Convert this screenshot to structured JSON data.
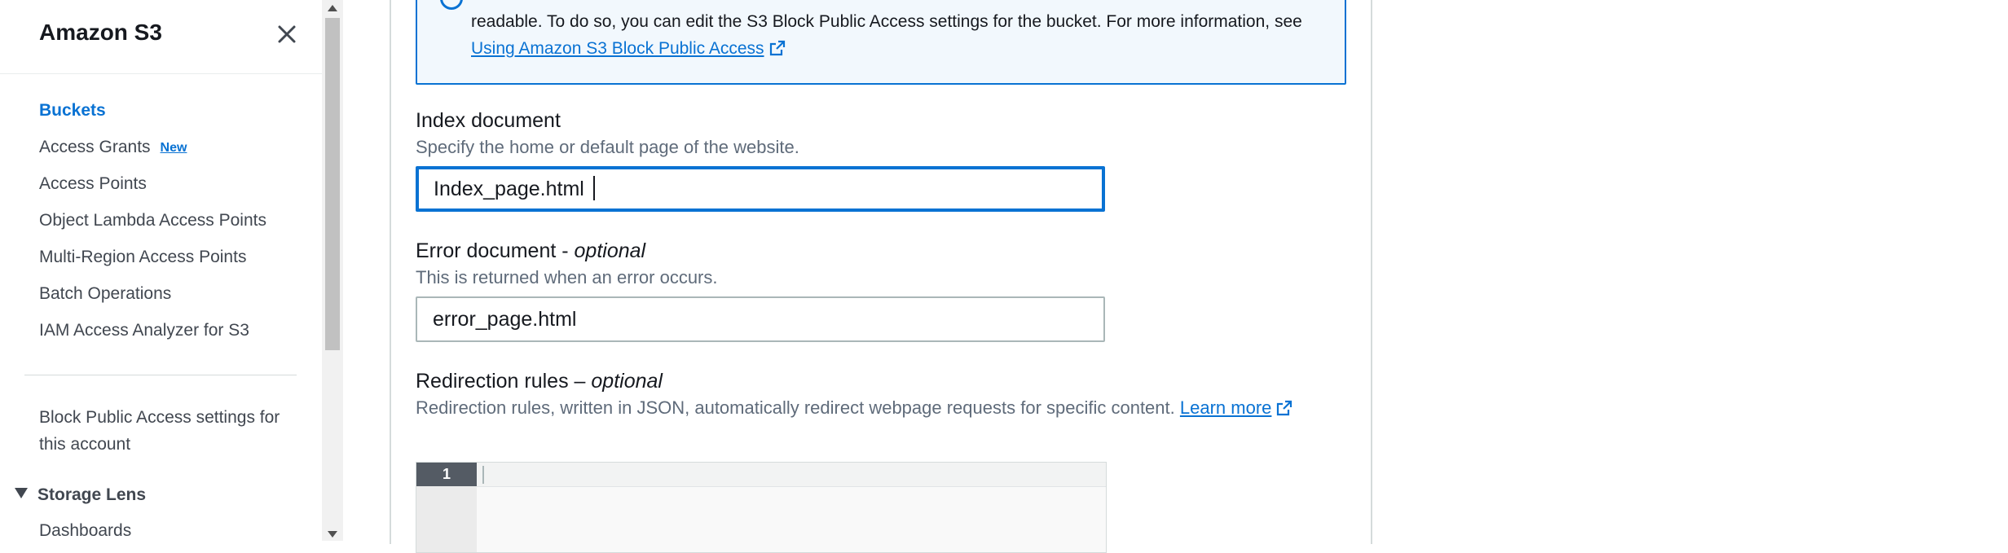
{
  "sidebar": {
    "title": "Amazon S3",
    "close_icon": "close-icon",
    "items": [
      {
        "label": "Buckets",
        "active": true
      },
      {
        "label": "Access Grants",
        "badge": "New"
      },
      {
        "label": "Access Points"
      },
      {
        "label": "Object Lambda Access Points"
      },
      {
        "label": "Multi-Region Access Points"
      },
      {
        "label": "Batch Operations"
      },
      {
        "label": "IAM Access Analyzer for S3"
      }
    ],
    "block_public_access": "Block Public Access settings for this account",
    "section": {
      "label": "Storage Lens",
      "expanded": true,
      "items": [
        {
          "label": "Dashboards"
        }
      ]
    }
  },
  "info_alert": {
    "text": "readable. To do so, you can edit the S3 Block Public Access settings for the bucket. For more information, see",
    "link_label": "Using Amazon S3 Block Public Access"
  },
  "index_document": {
    "label": "Index document",
    "description": "Specify the home or default page of the website.",
    "value": "Index_page.html"
  },
  "error_document": {
    "label": "Error document - ",
    "optional": "optional",
    "description": "This is returned when an error occurs.",
    "value": "error_page.html"
  },
  "redirection_rules": {
    "label": "Redirection rules – ",
    "optional": "optional",
    "description": "Redirection rules, written in JSON, automatically redirect webpage requests for specific content.",
    "learn_more": "Learn more",
    "editor": {
      "line_number": "1",
      "content": ""
    }
  },
  "colors": {
    "accent": "#0972d3",
    "info_bg": "#f2f8fd",
    "text": "#16191f",
    "muted": "#5f6b7a"
  }
}
